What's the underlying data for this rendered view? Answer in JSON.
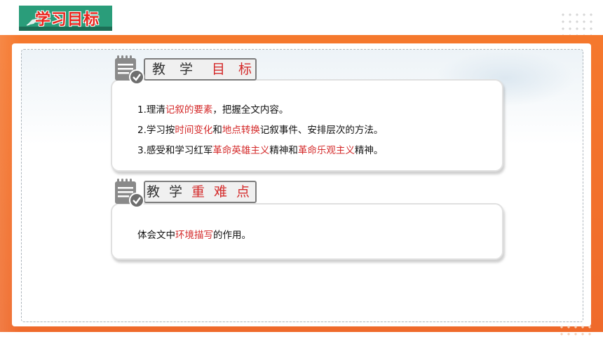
{
  "header": {
    "title": "学习目标"
  },
  "section_goals": {
    "label_chars": [
      "教",
      "学",
      "目",
      "标"
    ],
    "items": [
      {
        "num": "1.",
        "parts": [
          {
            "t": "理清",
            "red": false
          },
          {
            "t": "记叙的要素",
            "red": true
          },
          {
            "t": "，把握全文内容。",
            "red": false
          }
        ]
      },
      {
        "num": "2.",
        "parts": [
          {
            "t": "学习按",
            "red": false
          },
          {
            "t": "时间变化",
            "red": true
          },
          {
            "t": "和",
            "red": false
          },
          {
            "t": "地点转换",
            "red": true
          },
          {
            "t": "记叙事件、安排层次的方法。",
            "red": false
          }
        ]
      },
      {
        "num": "3.",
        "parts": [
          {
            "t": "感受和学习红军",
            "red": false
          },
          {
            "t": "革命英雄主义",
            "red": true
          },
          {
            "t": "精神和",
            "red": false
          },
          {
            "t": "革命乐观主义",
            "red": true
          },
          {
            "t": "精神。",
            "red": false
          }
        ]
      }
    ]
  },
  "section_difficulty": {
    "label_chars": [
      "教",
      "学",
      "重",
      "难",
      "点"
    ],
    "items": [
      {
        "parts": [
          {
            "t": "体会文中",
            "red": false
          },
          {
            "t": "环境描写",
            "red": true
          },
          {
            "t": "的作用。",
            "red": false
          }
        ]
      }
    ]
  },
  "colors": {
    "accent_red": "#d42a2a",
    "frame_orange": "#f5782d",
    "header_green": "#2a9d7a"
  },
  "icons": [
    "notepad-check-icon",
    "dot-grid-decoration"
  ]
}
